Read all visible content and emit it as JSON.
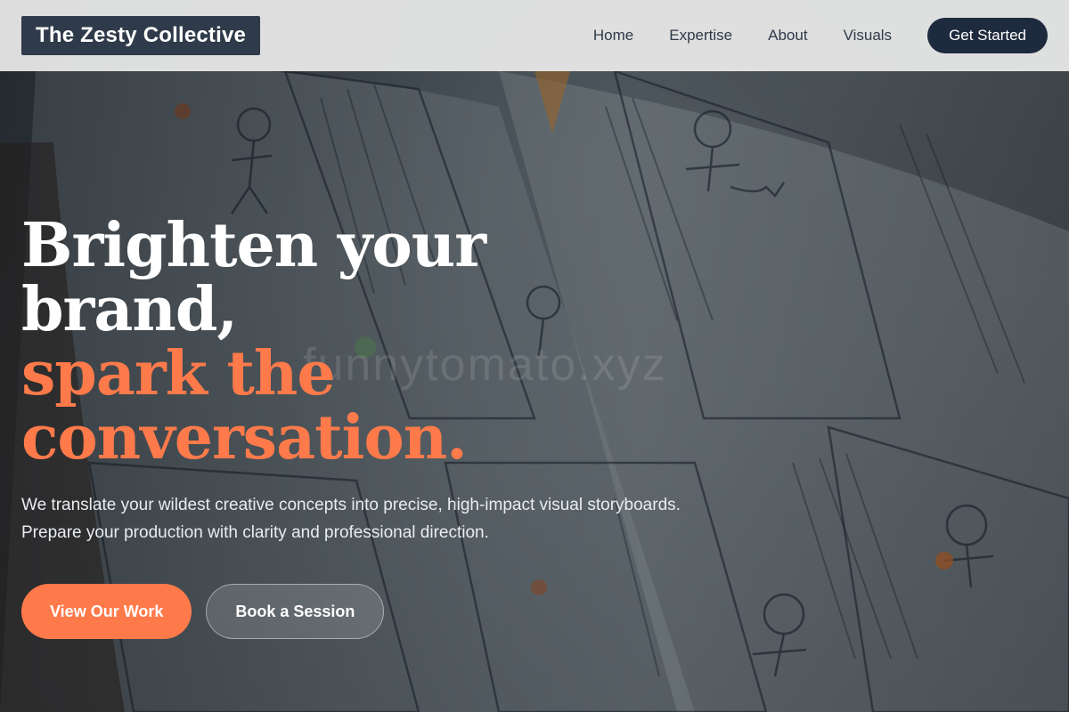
{
  "nav": {
    "brand": "The Zesty Collective",
    "links": [
      "Home",
      "Expertise",
      "About",
      "Visuals"
    ],
    "cta": "Get Started"
  },
  "hero": {
    "headline_line1": "Brighten your brand,",
    "headline_accent_line1": "spark the",
    "headline_accent_line2": "conversation.",
    "subtext": "We translate your wildest creative concepts into precise, high-impact visual storyboards. Prepare your production with clarity and professional direction.",
    "primary_button": "View Our Work",
    "secondary_button": "Book a Session",
    "watermark": "funnytomato.xyz"
  },
  "colors": {
    "accent": "#ff7a4a",
    "nav_bg": "#e5e5e5",
    "brand_bg": "#2f3a4a",
    "cta_bg": "#1e2a3e"
  }
}
